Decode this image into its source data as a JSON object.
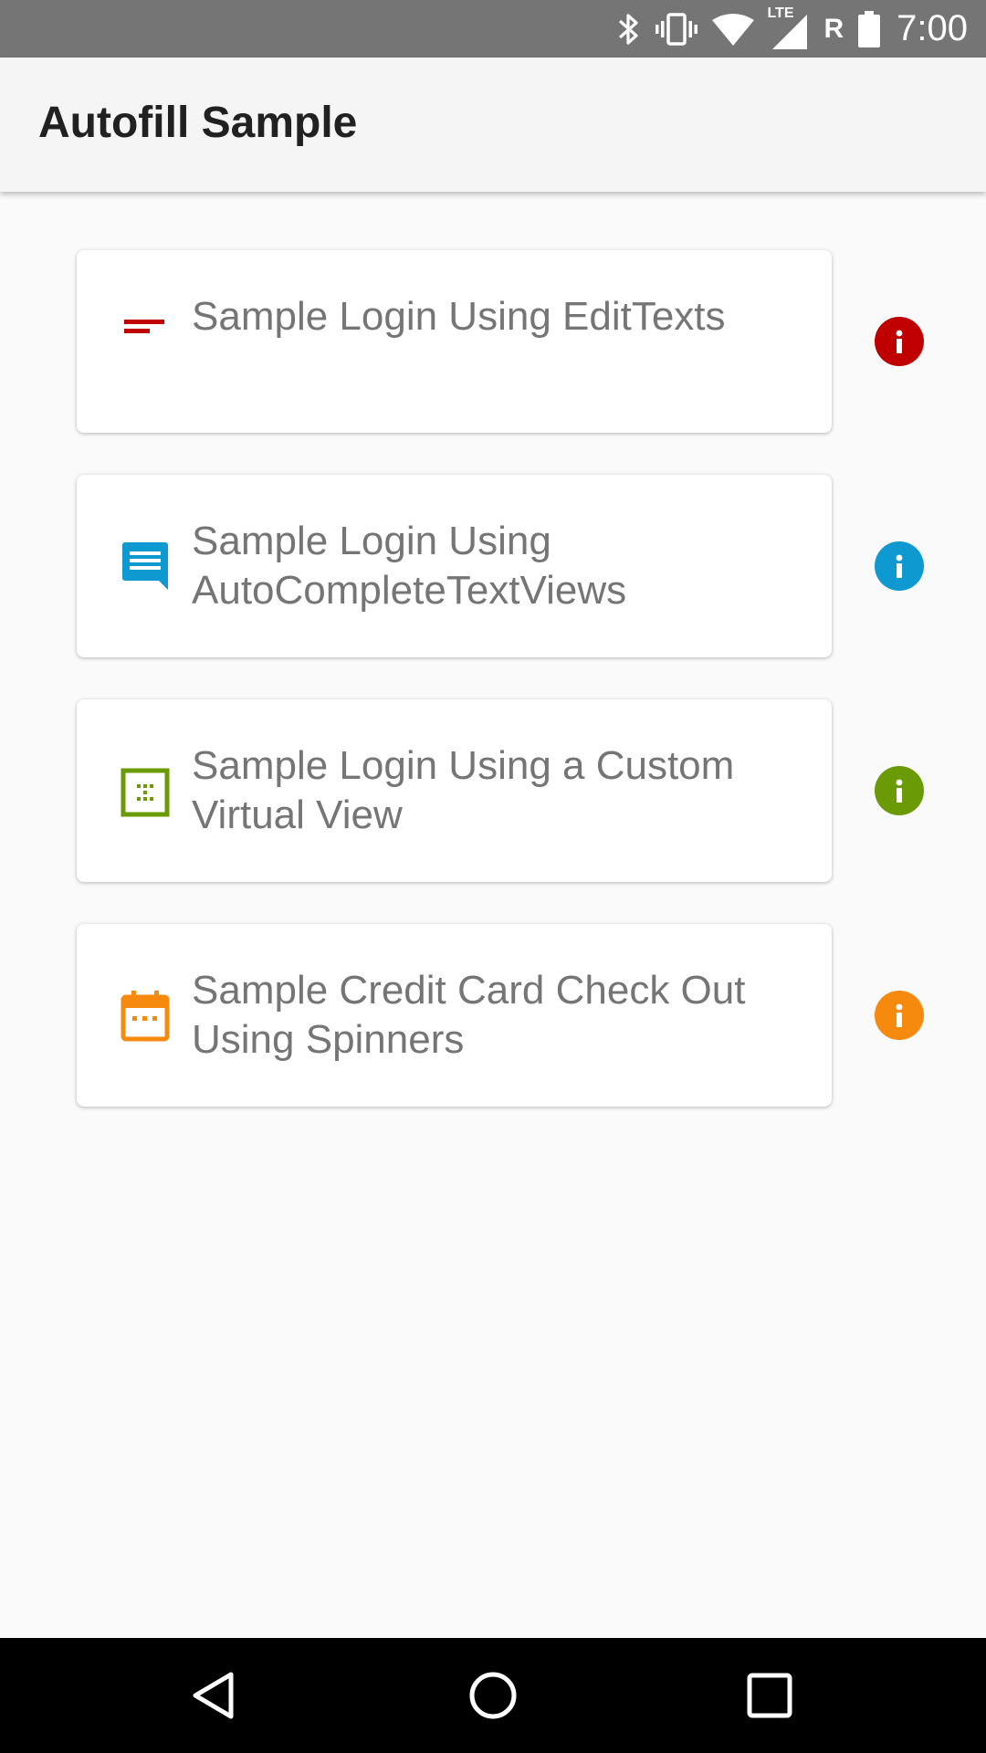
{
  "status_bar": {
    "time": "7:00",
    "network_label": "LTE",
    "roaming_label": "R",
    "icons": [
      "bluetooth-icon",
      "vibrate-icon",
      "wifi-icon",
      "cell-signal-icon",
      "battery-icon"
    ]
  },
  "app_bar": {
    "title": "Autofill Sample"
  },
  "items": [
    {
      "label": "Sample Login Using EditTexts",
      "icon": "short-text-icon",
      "color": "#c00000"
    },
    {
      "label": "Sample Login Using AutoCompleteTextViews",
      "icon": "chat-bubble-icon",
      "color": "#0e99d0"
    },
    {
      "label": "Sample Login Using a Custom Virtual View",
      "icon": "grid-square-icon",
      "color": "#6a9a05"
    },
    {
      "label": "Sample Credit Card Check Out Using Spinners",
      "icon": "calendar-icon",
      "color": "#f58a0f"
    }
  ],
  "info_icon": "info-icon",
  "nav_bar": {
    "icons": [
      "back-icon",
      "home-icon",
      "recents-icon"
    ]
  }
}
